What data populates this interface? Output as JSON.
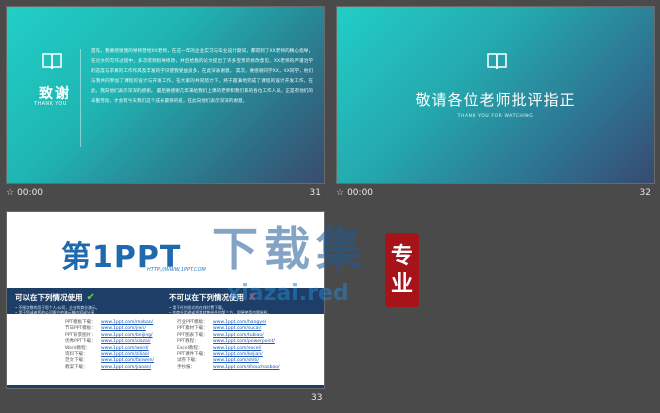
{
  "slides": [
    {
      "number": "31",
      "time": "00:00",
      "title": "致谢",
      "subtitle": "THANK YOU",
      "body": "首先，我要感谢我的导师曾经XX老师，在这一年的企业实习与毕业设计期间，都得到了XX老师的精心指导，在论文的写作过程中，多次得到指导修改，并且给我的论文提出了许多宝贵的修改意见，XX老师的严谨治学的态度与求真的工作作风及丰富的学识使我受益良多，在此深表谢意。 其次，要感谢同学XX，XX同学，他们与我共同参加了课程的设计与开发工作，在大家的共同努力下，终于圆满地完成了课程的设计开发工作，在此，我向他们表示深深的感谢。 最后要感谢几年来给我们上课的老师和我们系的各位工作人员，正是有他们的辛勤劳动，才会有今天我们这个成长最快的班，在此向他们表示深深的谢意。"
    },
    {
      "number": "32",
      "time": "00:00",
      "title": "敬请各位老师批评指正",
      "subtitle": "THANK YOU FOR WATCHING"
    },
    {
      "number": "33",
      "time": "",
      "logo_text": "第1PPT",
      "logo_url": "HTTP://WWW.1PPT.COM",
      "col1_head": "可以在下列情况使用",
      "col2_head": "不可以在下列情况使用",
      "col1_notes": [
        "• 不限次数的用于您个人/公司，企业的商业演示。",
        "• 用于您或者您的公司客户的演示稿内容或分享"
      ],
      "col2_notes": [
        "• 用于任何形式的在线付费下载。",
        "• 作商业用途或将其转售给任何第三方，即便使用也需授权。"
      ],
      "col1_links": [
        {
          "label": "PPT模板下载：",
          "url": "www.1ppt.com/moban/"
        },
        {
          "label": "节日PPT模板：",
          "url": "www.1ppt.com/jieri/"
        },
        {
          "label": "PPT背景图片：",
          "url": "www.1ppt.com/beijing/"
        },
        {
          "label": "优秀PPT下载：",
          "url": "www.1ppt.com/xiazai/"
        },
        {
          "label": "Word教程：",
          "url": "www.1ppt.com/word/"
        },
        {
          "label": "资料下载：",
          "url": "www.1ppt.com/ziliao/"
        },
        {
          "label": "范文下载：",
          "url": "www.1ppt.com/fanwen/"
        },
        {
          "label": "教案下载：",
          "url": "www.1ppt.com/jiaoan/"
        }
      ],
      "col2_links": [
        {
          "label": "行业PPT模板：",
          "url": "www.1ppt.com/hangye/"
        },
        {
          "label": "PPT素材下载：",
          "url": "www.1ppt.com/sucai/"
        },
        {
          "label": "PPT图表下载：",
          "url": "www.1ppt.com/tubiao/"
        },
        {
          "label": "PPT教程：",
          "url": "www.1ppt.com/powerpoint/"
        },
        {
          "label": "Excel教程：",
          "url": "www.1ppt.com/excel/"
        },
        {
          "label": "PPT课件下载：",
          "url": "www.1ppt.com/kejian/"
        },
        {
          "label": "试卷下载：",
          "url": "www.1ppt.com/shiti/"
        },
        {
          "label": "手抄报：",
          "url": "www.1ppt.com/shouchaobao/"
        }
      ]
    }
  ],
  "watermark": {
    "big": "下载集",
    "url": "xiazai.red",
    "seal_top": "专",
    "seal_bottom": "业"
  },
  "colors": {
    "background": "#4a4a4a",
    "teal": "#21cfc6",
    "navy": "#1d3f67",
    "seal": "#a6141a"
  },
  "icons": [
    "book-icon",
    "star-icon",
    "check-icon",
    "cross-icon"
  ]
}
